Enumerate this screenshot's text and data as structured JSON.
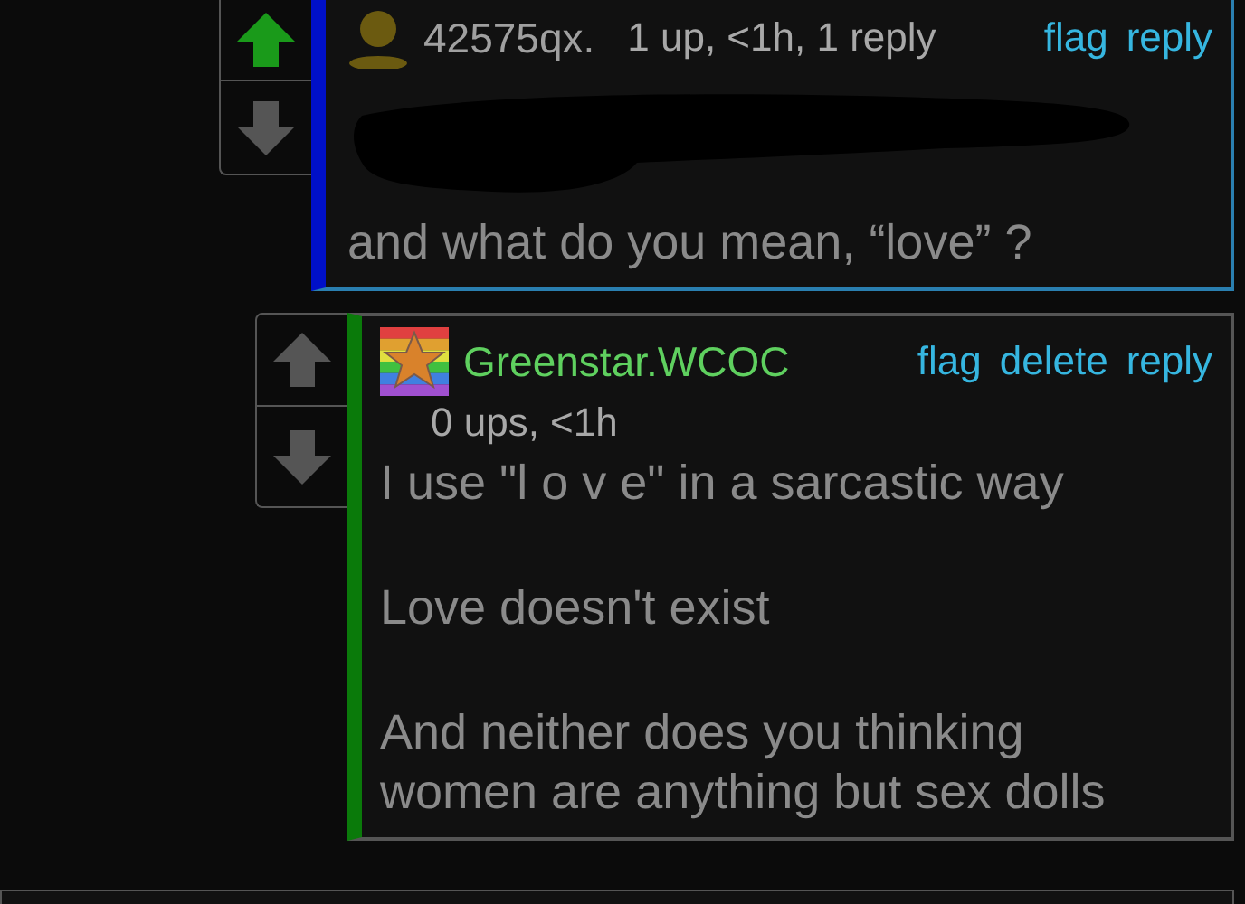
{
  "comments": [
    {
      "author": {
        "name": "42575qx.",
        "color": "#a0a0a0",
        "kind": "silhouette"
      },
      "meta": "1 up, <1h, 1 reply",
      "upvoted": true,
      "color": "#0010c8",
      "actions": [
        "flag",
        "reply"
      ],
      "body": [
        {
          "kind": "redacted"
        },
        {
          "kind": "text",
          "text": "and what do you mean, “love” ?"
        }
      ],
      "children": [
        {
          "author": {
            "name": "Greenstar.WCOC",
            "color": "#5fd05f",
            "kind": "star"
          },
          "meta": "0 ups, <1h",
          "upvoted": false,
          "color": "#0a7a0a",
          "actions": [
            "flag",
            "delete",
            "reply"
          ],
          "body": [
            {
              "kind": "text",
              "text": "I use \"l o v e\" in a sarcastic way"
            },
            {
              "kind": "gap"
            },
            {
              "kind": "text",
              "text": "Love doesn't exist"
            },
            {
              "kind": "gap"
            },
            {
              "kind": "text",
              "text": "And neither does you thinking women are anything but sex dolls"
            }
          ]
        }
      ]
    }
  ]
}
